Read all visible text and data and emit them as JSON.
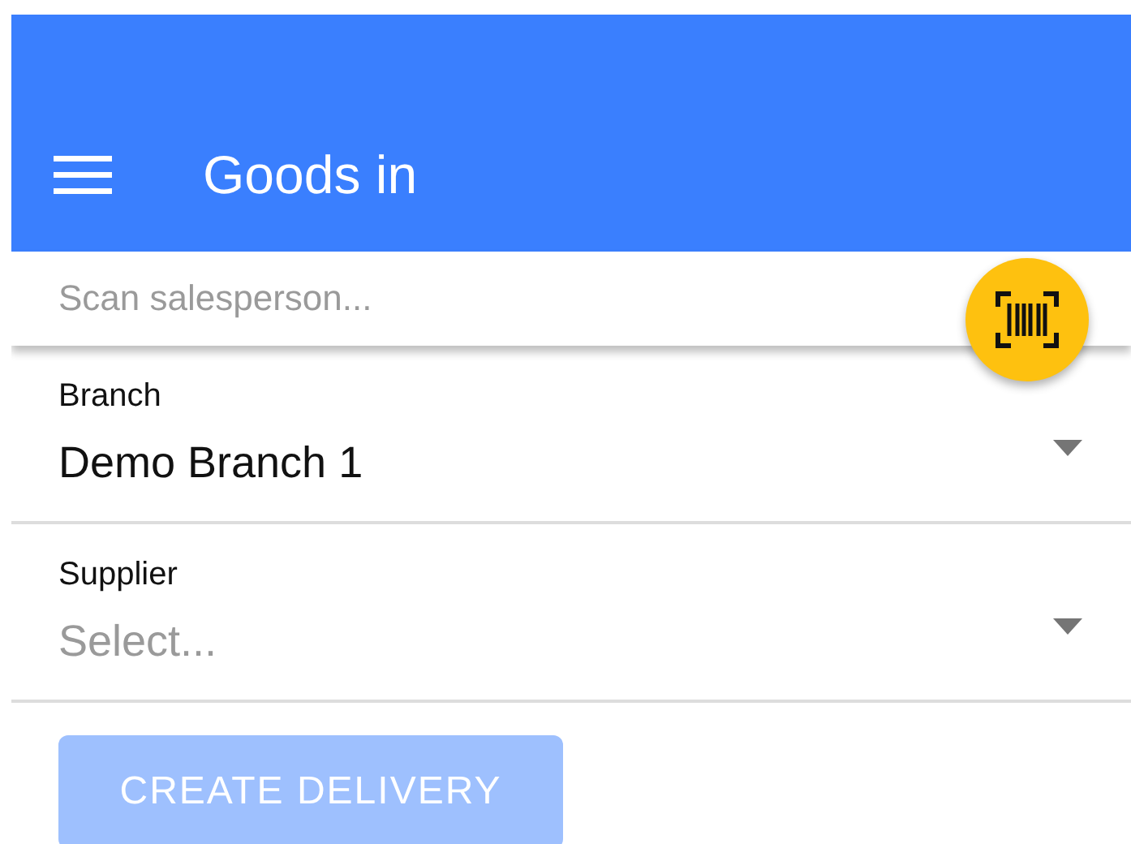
{
  "app_bar": {
    "title": "Goods in"
  },
  "scan_field": {
    "placeholder": "Scan salesperson..."
  },
  "fields": [
    {
      "label": "Branch",
      "value": "Demo Branch 1"
    },
    {
      "label": "Supplier",
      "placeholder": "Select..."
    }
  ],
  "button": {
    "label": "CREATE DELIVERY",
    "disabled": true
  }
}
